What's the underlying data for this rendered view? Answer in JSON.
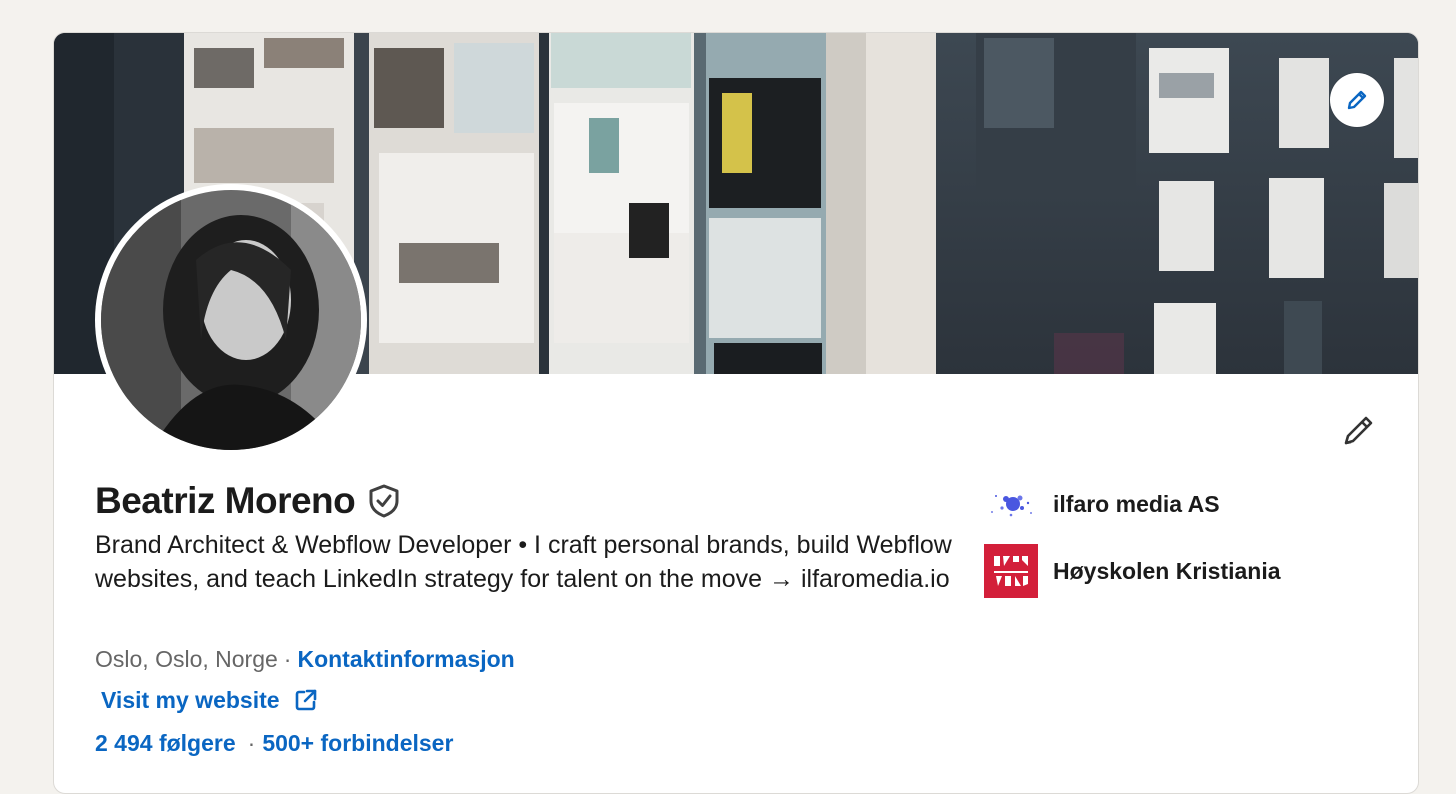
{
  "profile": {
    "name": "Beatriz Moreno",
    "headline": "Brand Architect & Webflow Developer • I craft personal brands, build Webflow websites, and teach LinkedIn strategy for talent on the move → ilfaromedia.io",
    "location": "Oslo, Oslo, Norge",
    "separator": "·",
    "contact_link": "Kontaktinformasjon",
    "website_link": "Visit my website",
    "followers": "2 494 følgere",
    "stats_separator": "·",
    "connections": "500+ forbindelser"
  },
  "affiliations": [
    {
      "name": "ilfaro media AS",
      "logo_icon": "ilfaro-splash-logo"
    },
    {
      "name": "Høyskolen Kristiania",
      "logo_icon": "kristiania-logo"
    }
  ],
  "icons": {
    "cover_edit": "pencil-icon",
    "intro_edit": "pencil-icon",
    "verified": "shield-check-icon",
    "external_link": "external-link-icon"
  },
  "colors": {
    "link_blue": "#0a66c2",
    "text_primary": "#1b1b1b",
    "text_secondary": "#666666",
    "page_bg": "#f4f2ee",
    "kristiania_red": "#d31f3a",
    "ilfaro_blue": "#4a57e0"
  }
}
